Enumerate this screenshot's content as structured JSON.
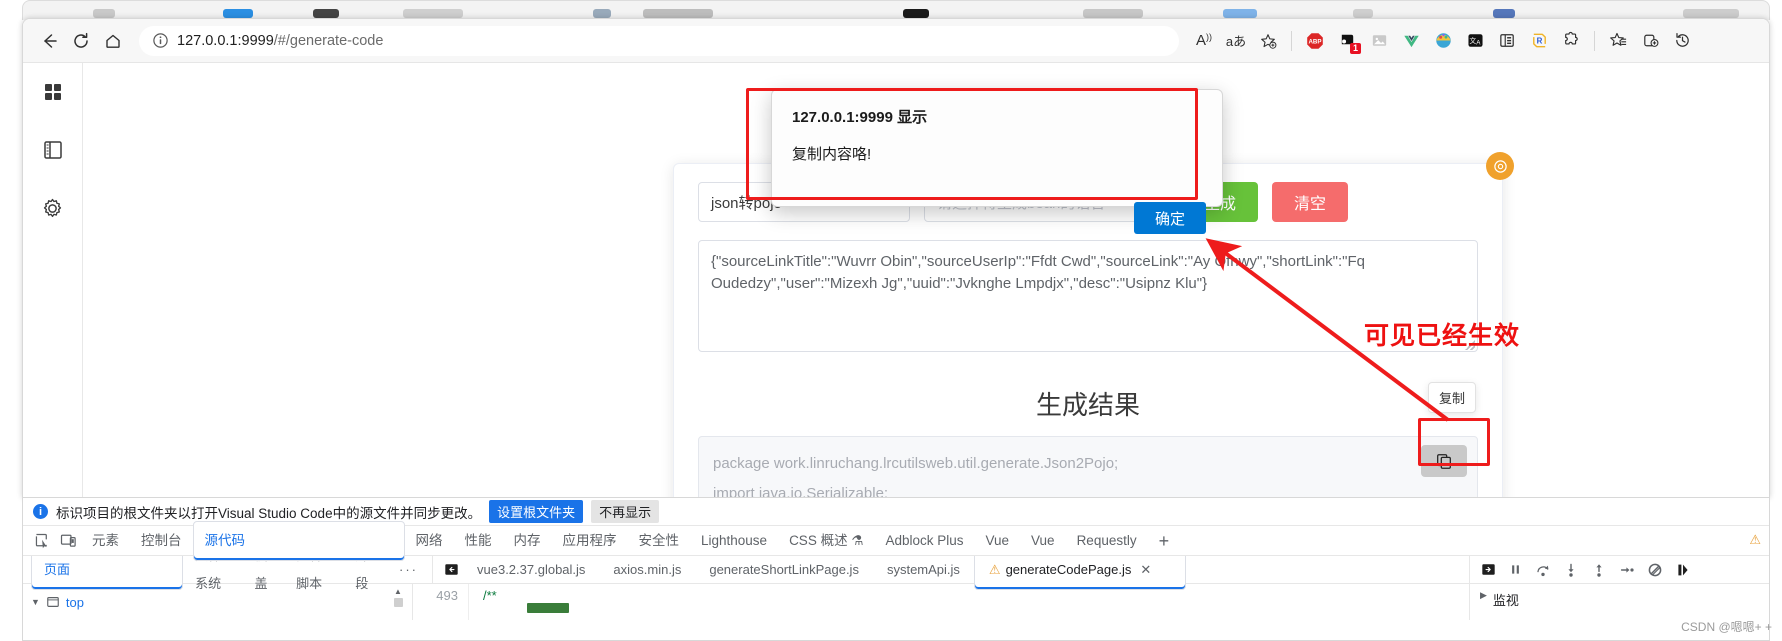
{
  "browser": {
    "url_host": "127.0.0.1:9999",
    "url_path": "/#/generate-code",
    "nav": {
      "back": "back-arrow",
      "reload": "reload",
      "home": "home"
    },
    "toolbar_icons": [
      {
        "name": "read-aloud-icon",
        "glyph": "A"
      },
      {
        "name": "translate-icon",
        "glyph": "aあ"
      },
      {
        "name": "add-favorite-icon",
        "glyph": "★"
      },
      {
        "name": "adblock-plus-icon",
        "glyph": "ABP"
      },
      {
        "name": "extension-badge-icon",
        "glyph": "1"
      },
      {
        "name": "image-extension-icon",
        "glyph": "▣"
      },
      {
        "name": "vue-devtools-icon",
        "glyph": "V"
      },
      {
        "name": "colorful-extension-icon",
        "glyph": "●"
      },
      {
        "name": "immersive-translate-icon",
        "glyph": "译"
      },
      {
        "name": "split-screen-icon",
        "glyph": "▤"
      },
      {
        "name": "requestly-icon",
        "glyph": "R"
      },
      {
        "name": "extensions-puzzle-icon",
        "glyph": "🧩"
      },
      {
        "name": "collections-icon",
        "glyph": "☆"
      },
      {
        "name": "add-tab-group-icon",
        "glyph": "⊞"
      },
      {
        "name": "history-icon",
        "glyph": "↺"
      }
    ]
  },
  "sidebar": {
    "items": [
      {
        "name": "apps-grid-icon",
        "label": "应用网格"
      },
      {
        "name": "notebook-icon",
        "label": "笔记"
      },
      {
        "name": "settings-gear-icon",
        "label": "设置"
      }
    ]
  },
  "alert": {
    "title": "127.0.0.1:9999 显示",
    "message": "复制内容咯!",
    "ok_label": "确定"
  },
  "form": {
    "mode_value": "json转pojo",
    "lang_placeholder": "请选择待生成bean的语言",
    "generate_label": "生成",
    "clear_label": "清空",
    "json_input": "{\"sourceLinkTitle\":\"Wuvrr Obin\",\"sourceUserIp\":\"Ffdt Cwd\",\"sourceLink\":\"Ay Ofnwy\",\"shortLink\":\"Fq Oudedzy\",\"user\":\"Mizexh Jg\",\"uuid\":\"Jvknghe Lmpdjx\",\"desc\":\"Usipnz Klu\"}"
  },
  "result": {
    "title": "生成结果",
    "copy_tooltip": "复制",
    "copy_icon": "copy-icon",
    "code_line_1": "package work.linruchang.lrcutilsweb.util.generate.Json2Pojo;",
    "code_line_2": "import java.io.Serializable;"
  },
  "annotations": {
    "effective_note": "可见已经生效"
  },
  "devtools": {
    "notice": {
      "text": "标识项目的根文件夹以打开Visual Studio Code中的源文件并同步更改。",
      "primary_label": "设置根文件夹",
      "secondary_label": "不再显示"
    },
    "tabs": [
      {
        "label": "元素",
        "selected": false
      },
      {
        "label": "控制台",
        "selected": false
      },
      {
        "label": "源代码",
        "selected": true
      },
      {
        "label": "网络",
        "selected": false
      },
      {
        "label": "性能",
        "selected": false
      },
      {
        "label": "内存",
        "selected": false
      },
      {
        "label": "应用程序",
        "selected": false
      },
      {
        "label": "安全性",
        "selected": false
      },
      {
        "label": "Lighthouse",
        "selected": false
      },
      {
        "label": "CSS 概述",
        "selected": false
      },
      {
        "label": "Adblock Plus",
        "selected": false
      },
      {
        "label": "Vue",
        "selected": false
      },
      {
        "label": "Vue",
        "selected": false
      },
      {
        "label": "Requestly",
        "selected": false
      }
    ],
    "add_tab_label": "+",
    "sub_tabs": [
      {
        "label": "页面",
        "selected": true
      },
      {
        "label": "文件系统",
        "selected": false
      },
      {
        "label": "覆盖",
        "selected": false
      },
      {
        "label": "内容脚本",
        "selected": false
      },
      {
        "label": "片段",
        "selected": false
      }
    ],
    "more_label": "···",
    "file_tabs": [
      {
        "label": "vue3.2.37.global.js",
        "selected": false,
        "warn": false
      },
      {
        "label": "axios.min.js",
        "selected": false,
        "warn": false
      },
      {
        "label": "generateShortLinkPage.js",
        "selected": false,
        "warn": false
      },
      {
        "label": "systemApi.js",
        "selected": false,
        "warn": false
      },
      {
        "label": "generateCodePage.js",
        "selected": true,
        "warn": true
      }
    ],
    "tree_root": "top",
    "line_number": "493",
    "code_snippet": "/**",
    "watch_label": "监视"
  },
  "watermark": "CSDN @嗯嗯+ +"
}
